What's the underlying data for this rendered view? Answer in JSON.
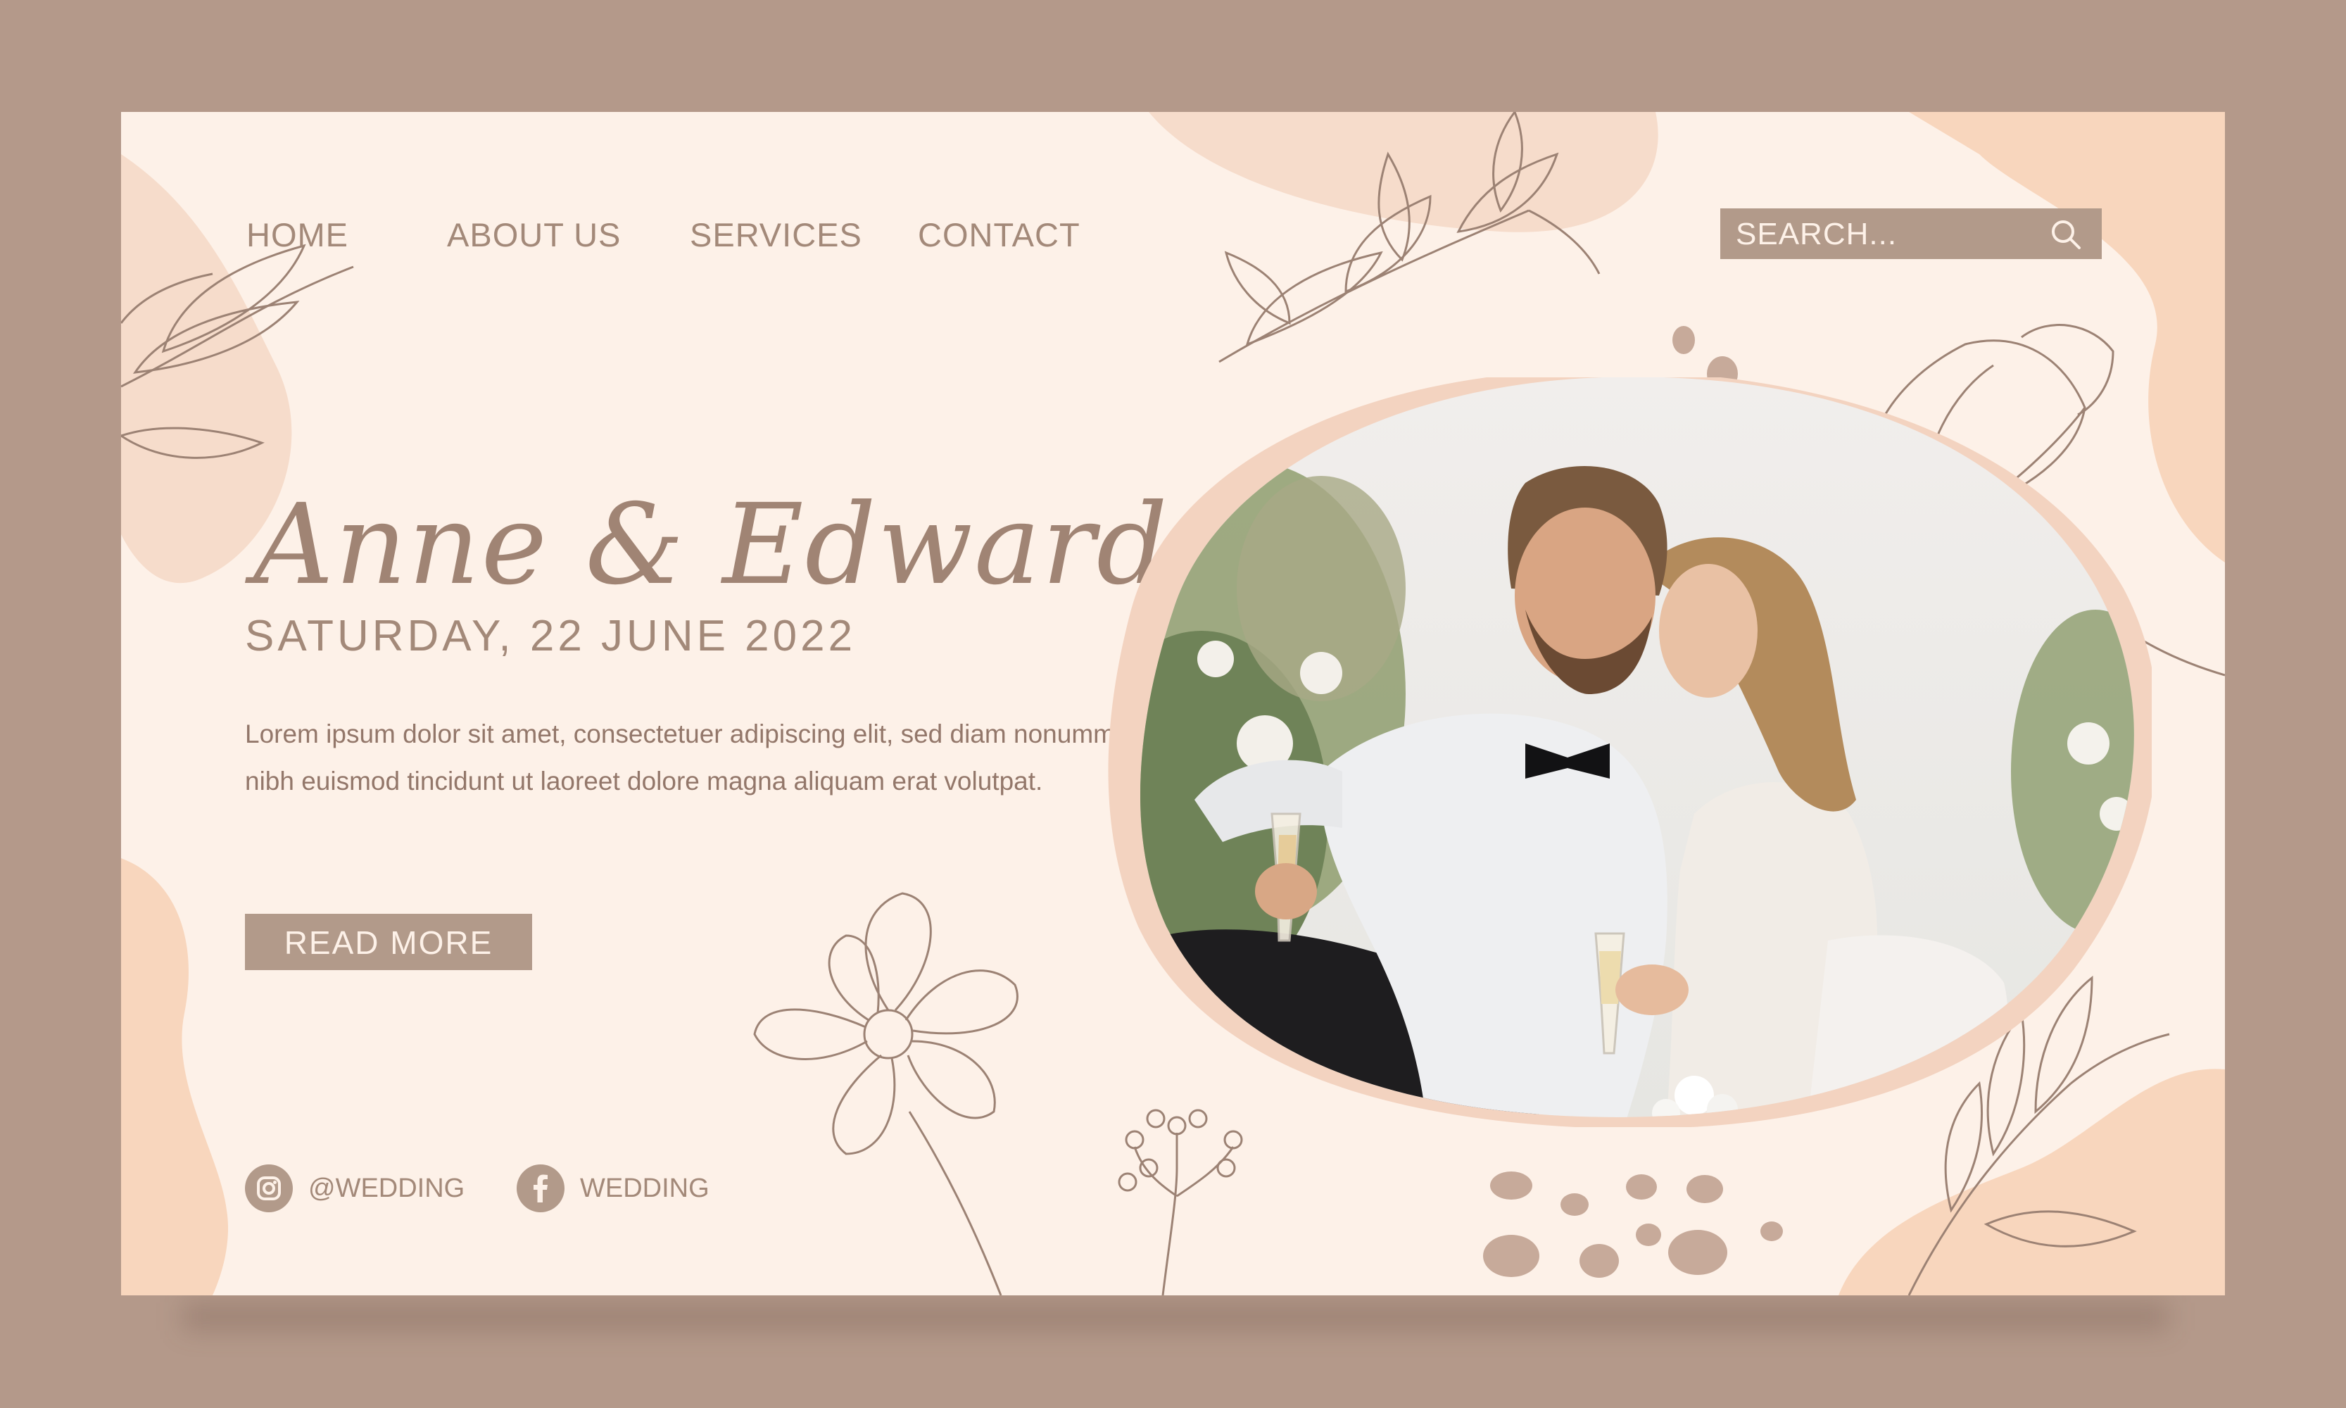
{
  "nav": {
    "items": [
      {
        "label": "HOME"
      },
      {
        "label": "ABOUT US"
      },
      {
        "label": "SERVICES"
      },
      {
        "label": "CONTACT"
      }
    ]
  },
  "search": {
    "placeholder": "SEARCH..."
  },
  "hero": {
    "names": "Anne & Edward",
    "date": "SATURDAY, 22 JUNE 2022",
    "description": "Lorem ipsum dolor sit amet, consectetuer adipiscing elit, sed diam nonummy nibh euismod tincidunt ut laoreet dolore magna aliquam erat volutpat.",
    "button_label": "READ MORE"
  },
  "social": {
    "instagram": {
      "label": "@WEDDING",
      "icon": "instagram-icon"
    },
    "facebook": {
      "label": "WEDDING",
      "icon": "facebook-icon"
    }
  },
  "colors": {
    "frame": "#b4998a",
    "page": "#fdf1e8",
    "accent": "#b29a8a",
    "text": "#a38979",
    "blob": "#f6dccb"
  }
}
